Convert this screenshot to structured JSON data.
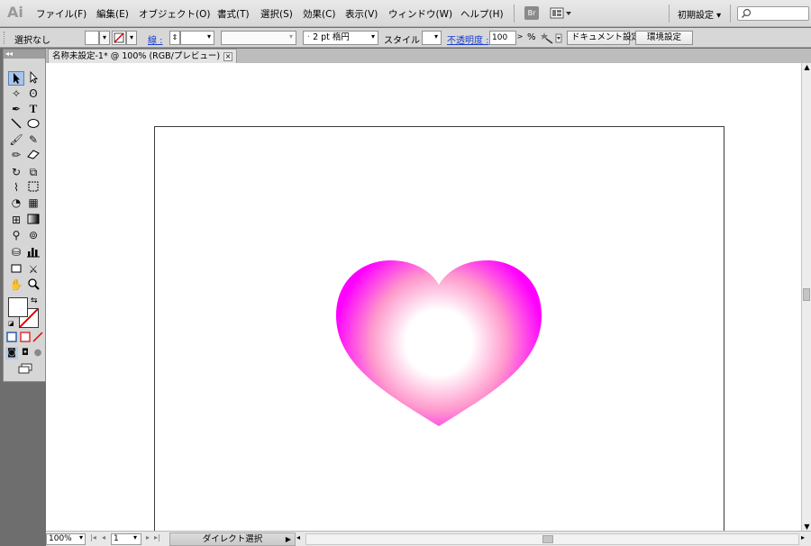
{
  "app": {
    "logo": "Ai"
  },
  "menu": {
    "items": [
      "ファイル(F)",
      "編集(E)",
      "オブジェクト(O)",
      "書式(T)",
      "選択(S)",
      "効果(C)",
      "表示(V)",
      "ウィンドウ(W)",
      "ヘルプ(H)"
    ],
    "bridge_icon": "Br",
    "workspace": "初期設定 ▾"
  },
  "control": {
    "selection": "選択なし",
    "stroke_label": "線 :",
    "stroke_weight": "2 pt 楕円",
    "style_label": "スタイル :",
    "opacity_label": "不透明度 :",
    "opacity_value": "100",
    "percent": "%",
    "doc_settings": "ドキュメント設定",
    "env_settings": "環境設定"
  },
  "document": {
    "tab_title": "名称未設定-1* @ 100% (RGB/プレビュー)",
    "close": "×"
  },
  "artwork": {
    "shape": "heart",
    "gradient_colors": [
      "#ffffff",
      "#ff99cc",
      "#ff00ff"
    ]
  },
  "status": {
    "zoom": "100%",
    "page": "1",
    "tool": "ダイレクト選択",
    "arrow": "▶"
  },
  "tools": {
    "collapse": "◂◂"
  }
}
